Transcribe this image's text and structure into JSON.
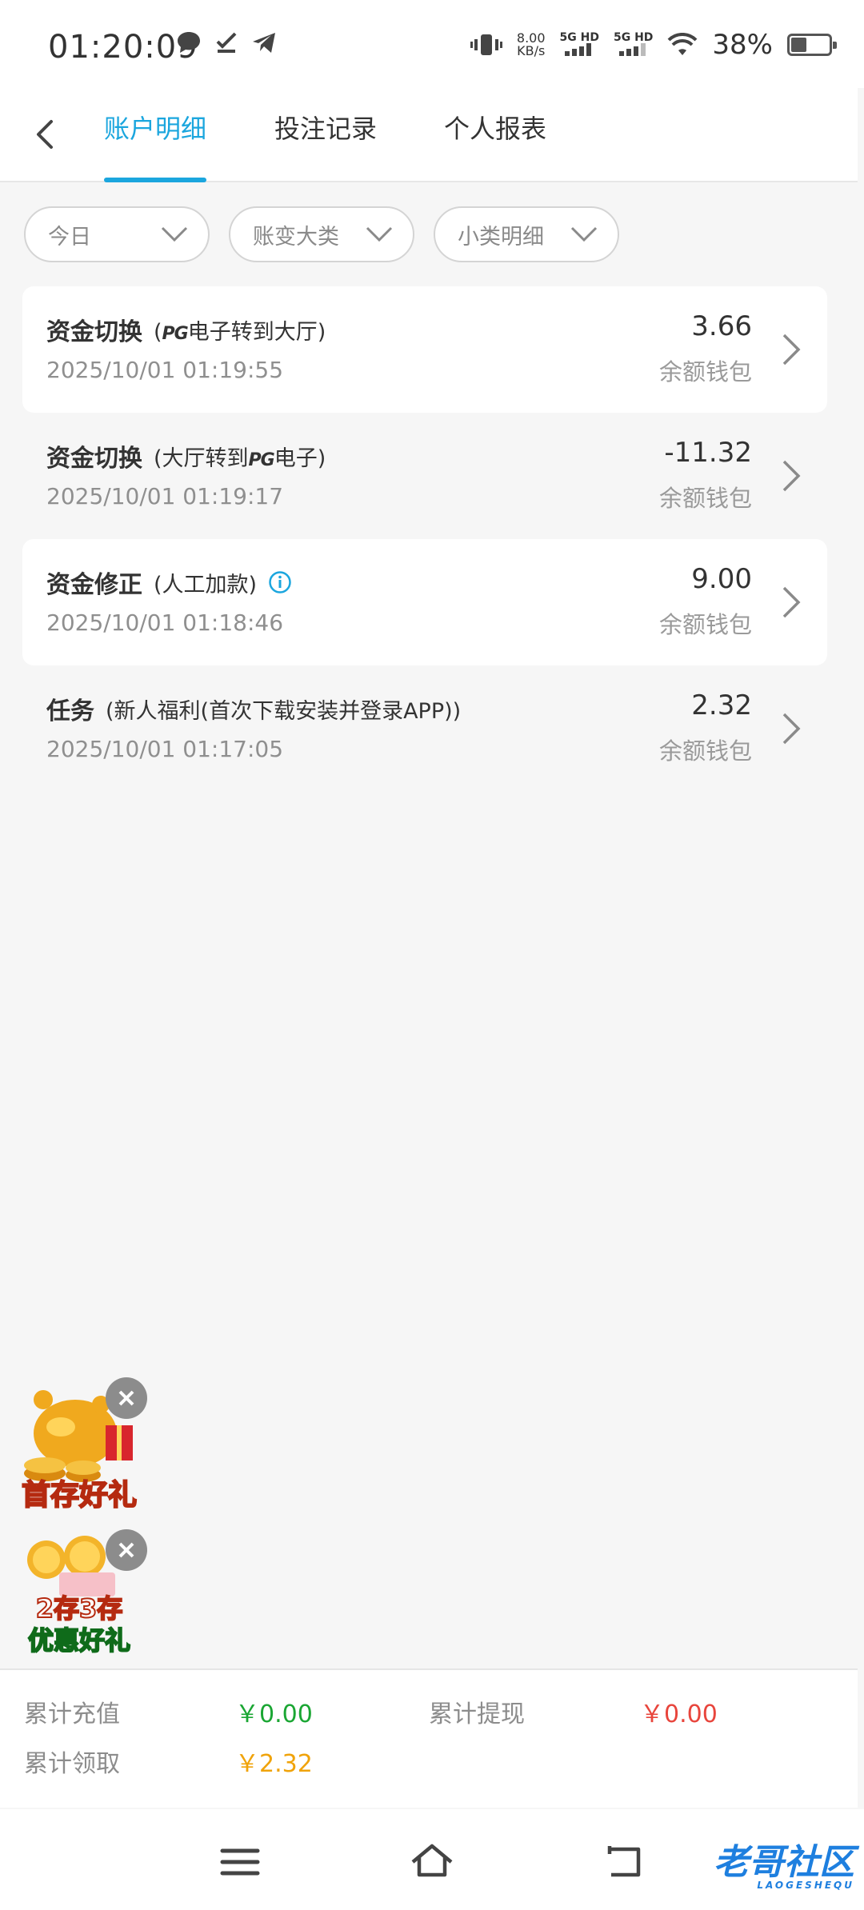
{
  "status_bar": {
    "time": "01:20:09",
    "speed_value": "8.00",
    "speed_unit": "KB/s",
    "net1": "5G HD",
    "net2": "5G HD",
    "battery_percent": "38%",
    "battery_level": 0.38
  },
  "header": {
    "tabs": [
      {
        "label": "账户明细",
        "active": true
      },
      {
        "label": "投注记录",
        "active": false
      },
      {
        "label": "个人报表",
        "active": false
      }
    ]
  },
  "filters": [
    {
      "label": "今日"
    },
    {
      "label": "账变大类"
    },
    {
      "label": "小类明细"
    }
  ],
  "records": [
    {
      "title": "资金切换",
      "sub_pre": "(",
      "sub_brand": "PG",
      "sub_post": "电子转到大厅)",
      "time": "2025/10/01 01:19:55",
      "amount": "3.66",
      "wallet": "余额钱包"
    },
    {
      "title": "资金切换",
      "sub_pre": "(大厅转到",
      "sub_brand": "PG",
      "sub_post": "电子)",
      "time": "2025/10/01 01:19:17",
      "amount": "-11.32",
      "wallet": "余额钱包"
    },
    {
      "title": "资金修正",
      "sub_pre": "(人工加款)",
      "sub_brand": "",
      "sub_post": "",
      "time": "2025/10/01 01:18:46",
      "amount": "9.00",
      "wallet": "余额钱包"
    },
    {
      "title": "任务",
      "sub_pre": "(新人福利(首次下载安装并登录APP))",
      "sub_brand": "",
      "sub_post": "",
      "time": "2025/10/01 01:17:05",
      "amount": "2.32",
      "wallet": "余额钱包"
    }
  ],
  "promos": [
    {
      "text": "首存好礼"
    },
    {
      "text_line1": "2存3存",
      "text_line2": "优惠好礼"
    }
  ],
  "summary": {
    "recharge_label": "累计充值",
    "recharge_value": "￥0.00",
    "withdraw_label": "累计提现",
    "withdraw_value": "￥0.00",
    "claim_label": "累计领取",
    "claim_value": "￥2.32",
    "colors": {
      "recharge": "#1aa633",
      "withdraw": "#e8453c",
      "claim": "#f0a30a"
    }
  },
  "watermark": {
    "text": "老哥社区",
    "sub": "LAOGESHEQU"
  }
}
